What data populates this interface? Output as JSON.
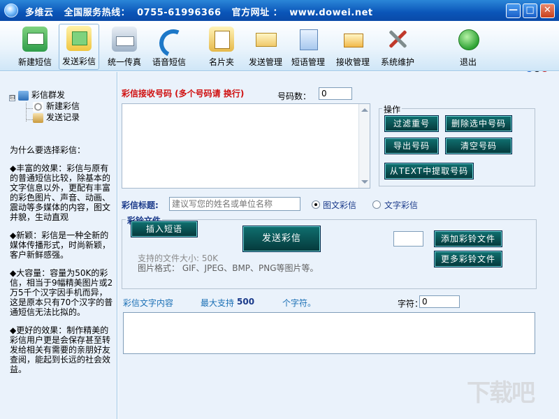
{
  "window": {
    "title": "多维云   全国服务热线：  0755-61996366   官方网址 ：  www.dowei.net",
    "min_glyph": "—",
    "max_glyph": "□",
    "close_glyph": "✕"
  },
  "toolbar": {
    "items": [
      {
        "label": "新建短信",
        "icon": "new-sms-icon"
      },
      {
        "label": "发送彩信",
        "icon": "send-mms-icon",
        "active": true
      },
      {
        "label": "统一传真",
        "icon": "fax-icon"
      },
      {
        "label": "语音短信",
        "icon": "voice-sms-icon"
      },
      {
        "label": "名片夹",
        "icon": "card-folder-icon"
      },
      {
        "label": "发送管理",
        "icon": "send-manage-icon"
      },
      {
        "label": "短语管理",
        "icon": "phrase-manage-icon"
      },
      {
        "label": "接收管理",
        "icon": "receive-manage-icon"
      },
      {
        "label": "系统维护",
        "icon": "maintenance-icon"
      },
      {
        "label": "退出",
        "icon": "exit-icon"
      }
    ]
  },
  "tree": {
    "expander": "⊟",
    "root": "彩信群发",
    "children": [
      "新建彩信",
      "发送记录"
    ]
  },
  "why": {
    "heading": "为什么要选择彩信：",
    "paras": [
      "◆丰富的效果：彩信与原有的普通短信比较，除基本的文字信息以外，更配有丰富的彩色图片、声音、动画、震动等多媒体的内容，图文并貌，生动直观",
      "◆新颖：彩信是一种全新的媒体传播形式，时尚新颖，客户新鲜感强。",
      "◆大容量：容量为50K的彩信，相当于9幅精美图片或2万5千个汉字因手机而异，这是原本只有70个汉字的普通短信无法比拟的。",
      "◆更好的效果：制作精美的彩信用户更是会保存甚至转发给相关有需要的亲朋好友查阅，能起到长远的社会效益。"
    ]
  },
  "recipients": {
    "label": "彩信接收号码 (多个号码请 换行)",
    "count_label": "号码数：",
    "count_value": "0"
  },
  "operations": {
    "title": "操作",
    "filter_dup": "过滤重号",
    "delete_selected": "删除选中号码",
    "export": "导出号码",
    "clear": "清空号码",
    "extract_text": "从TEXT中提取号码"
  },
  "subject": {
    "label": "彩信标题:",
    "placeholder": "建议写您的姓名或单位名称",
    "opt_image": "图文彩信",
    "opt_text": "文字彩信"
  },
  "file": {
    "title": "彩铃文件",
    "insert_phrase": "插入短语",
    "send": "发送彩信",
    "size_hint": "支持的文件大小: 50K",
    "format_hint": "图片格式：  GIF、JPEG、BMP、PNG等图片等。",
    "add_file": "添加彩铃文件",
    "more_files": "更多彩铃文件",
    "file_value": ""
  },
  "content": {
    "label": "彩信文字内容",
    "max_prefix": "最大支持",
    "max_value": "500",
    "max_suffix": "个字符。",
    "count_label": "字符：",
    "count_value": "0"
  },
  "watermark": "下载吧",
  "colors": {
    "title_bar": "#0a55b8",
    "accent_red": "#d01010",
    "button_teal": "#0f6e6e",
    "panel_bg": "#eaf2fb"
  }
}
